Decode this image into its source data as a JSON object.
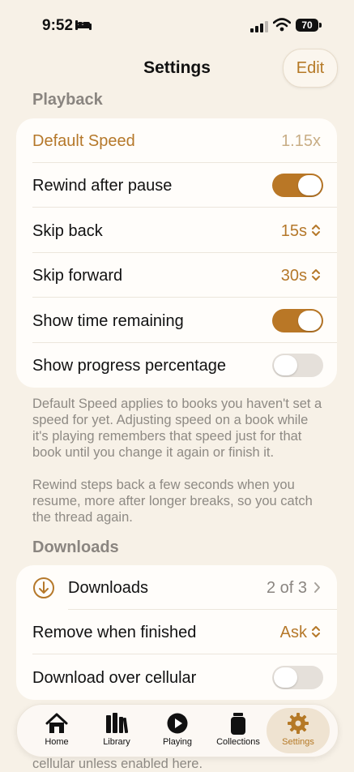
{
  "status": {
    "time": "9:52",
    "battery": "70"
  },
  "header": {
    "title": "Settings",
    "edit_label": "Edit"
  },
  "playback": {
    "section_title": "Playback",
    "rows": [
      {
        "label": "Default Speed",
        "value": "1.15x"
      },
      {
        "label": "Rewind after pause",
        "toggle": true
      },
      {
        "label": "Skip back",
        "value": "15s"
      },
      {
        "label": "Skip forward",
        "value": "30s"
      },
      {
        "label": "Show time remaining",
        "toggle": true
      },
      {
        "label": "Show progress percentage",
        "toggle": false
      }
    ],
    "footer_1": "Default Speed applies to books you haven't set a speed for yet. Adjusting speed on a book while it's playing remembers that speed just for that book until you change it again or finish it.",
    "footer_2": "Rewind steps back a few seconds when you resume, more after longer breaks, so you catch the thread again."
  },
  "downloads": {
    "section_title": "Downloads",
    "rows": [
      {
        "label": "Downloads",
        "value": "2 of 3"
      },
      {
        "label": "Remove when finished",
        "value": "Ask"
      },
      {
        "label": "Download over cellular",
        "toggle": false
      }
    ],
    "footer_partial": "cellular unless enabled here."
  },
  "tabbar": {
    "tabs": [
      {
        "label": "Home",
        "icon": "house-icon"
      },
      {
        "label": "Library",
        "icon": "books-icon"
      },
      {
        "label": "Playing",
        "icon": "play-circle-icon"
      },
      {
        "label": "Collections",
        "icon": "jar-icon"
      },
      {
        "label": "Settings",
        "icon": "gear-icon",
        "active": true
      }
    ]
  },
  "colors": {
    "accent": "#b57926",
    "background": "#f7f1e7",
    "card": "#fffdfa"
  }
}
